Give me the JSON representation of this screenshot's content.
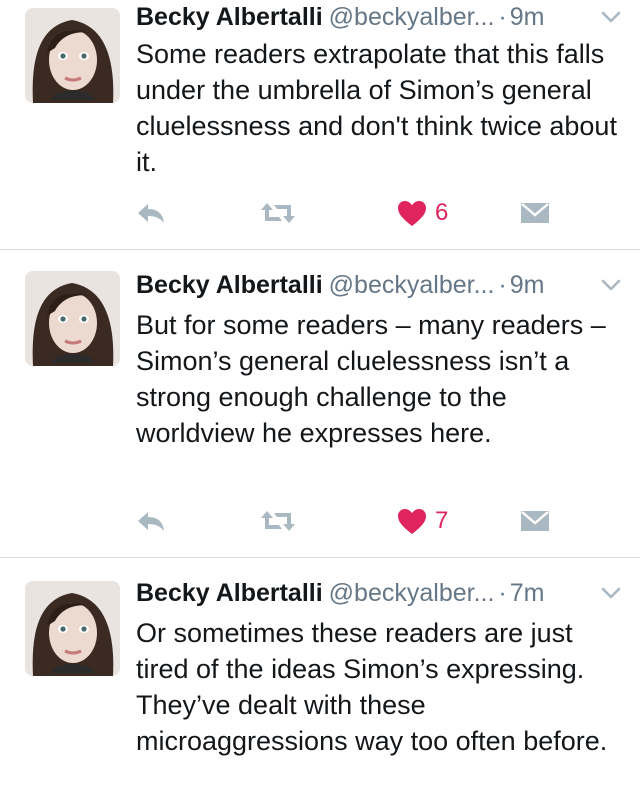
{
  "tweets": [
    {
      "author": {
        "name": "Becky Albertalli",
        "handle": "@beckyalber...",
        "time": "9m"
      },
      "separator": "·",
      "text": "Some readers extrapolate that this falls under the umbrella of Simon’s general cluelessness and don't think twice about it.",
      "likes": "6"
    },
    {
      "author": {
        "name": "Becky Albertalli",
        "handle": "@beckyalber...",
        "time": "9m"
      },
      "separator": "·",
      "text": "But for some readers – many readers – Simon’s general cluelessness isn’t a strong enough challenge to the worldview he expresses here.",
      "likes": "7"
    },
    {
      "author": {
        "name": "Becky Albertalli",
        "handle": "@beckyalber...",
        "time": "7m"
      },
      "separator": "·",
      "text": "Or sometimes these readers are just tired of the ideas Simon’s expressing. They’ve dealt with these microaggressions way too often before."
    }
  ],
  "icons": {
    "reply": "reply-icon",
    "retweet": "retweet-icon",
    "like": "heart-icon",
    "message": "envelope-icon",
    "caret": "chevron-down-icon"
  },
  "colors": {
    "like": "#e0245e",
    "icon_gray": "#aab8c2",
    "secondary_text": "#657786",
    "divider": "#d8dde2"
  }
}
